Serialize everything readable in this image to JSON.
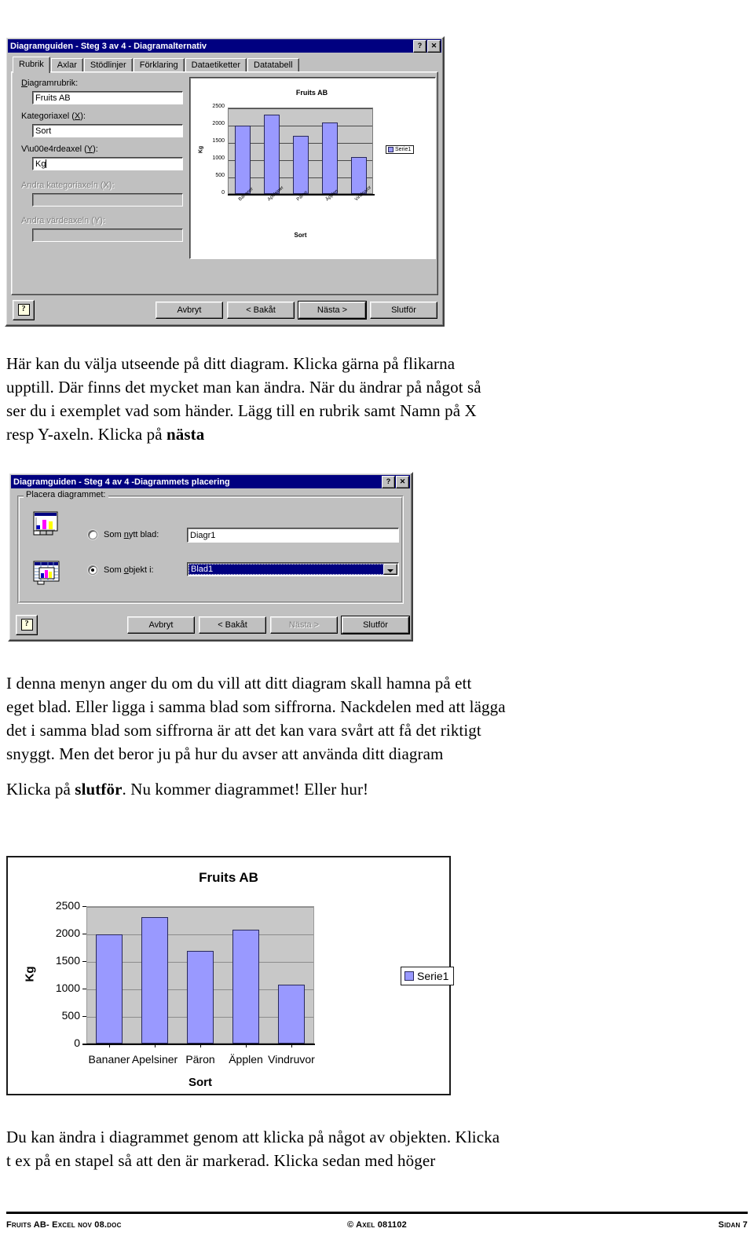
{
  "dialog3": {
    "title": "Diagramguiden - Steg 3 av 4 - Diagramalternativ",
    "help_btn": "?",
    "close_btn": "✕",
    "tabs": [
      {
        "label": "Rubrik",
        "active": true
      },
      {
        "label": "Axlar",
        "active": false
      },
      {
        "label": "Stödlinjer",
        "active": false
      },
      {
        "label": "Förklaring",
        "active": false
      },
      {
        "label": "Dataetiketter",
        "active": false
      },
      {
        "label": "Datatabell",
        "active": false
      }
    ],
    "fields": [
      {
        "label": "Diagramrubrik:",
        "value": "Fruits AB",
        "disabled": false,
        "caret": false
      },
      {
        "label": "Kategoriaxel (X):",
        "value": "Sort",
        "disabled": false,
        "caret": false
      },
      {
        "label": "Värdeaxel (Y):",
        "value": "Kg",
        "disabled": false,
        "caret": true
      },
      {
        "label": "Andra kategoriaxeln (X):",
        "value": "",
        "disabled": true,
        "caret": false
      },
      {
        "label": "Andra värdeaxeln (Y):",
        "value": "",
        "disabled": true,
        "caret": false
      }
    ],
    "buttons": [
      {
        "label": "Avbryt",
        "state": "normal"
      },
      {
        "label": "< Bakåt",
        "state": "normal"
      },
      {
        "label": "Nästa >",
        "state": "default"
      },
      {
        "label": "Slutför",
        "state": "normal"
      }
    ]
  },
  "dialog4": {
    "title": "Diagramguiden - Steg 4 av 4 -Diagrammets placering",
    "help_btn": "?",
    "close_btn": "✕",
    "group_label": "Placera diagrammet:",
    "options": [
      {
        "label": "Som nytt blad:",
        "selected": false,
        "value": "Diagr1",
        "control": "textbox"
      },
      {
        "label": "Som objekt i:",
        "selected": true,
        "value": "Blad1",
        "control": "combobox"
      }
    ],
    "buttons": [
      {
        "label": "Avbryt",
        "state": "normal"
      },
      {
        "label": "< Bakåt",
        "state": "normal"
      },
      {
        "label": "Nästa >",
        "state": "disabled"
      },
      {
        "label": "Slutför",
        "state": "default"
      }
    ]
  },
  "text": {
    "p1_line1": "Här kan du välja utseende på ditt diagram. Klicka gärna på flikarna",
    "p1_line2": "upptill. Där finns det mycket man kan ändra. När du ändrar på något så",
    "p1_line3": "ser du i exemplet vad som händer. Lägg till en rubrik samt Namn på X",
    "p1_line4_a": "resp Y-axeln. Klicka på ",
    "p1_line4_b": "nästa",
    "p2_line1": "I denna menyn anger du om du vill att ditt diagram skall hamna på ett",
    "p2_line2": "eget blad. Eller ligga i samma blad som siffrorna. Nackdelen med att lägga",
    "p2_line3": "det i samma blad som siffrorna är att det kan vara svårt att få det riktigt",
    "p2_line4": "snyggt. Men det beror ju på hur du avser att använda ditt diagram",
    "p3_a": "Klicka på ",
    "p3_b": "slutför",
    "p3_c": ". Nu kommer diagrammet! Eller hur!",
    "p4_line1": "Du kan ändra i diagrammet genom att klicka på något av objekten. Klicka",
    "p4_line2": "t ex på en stapel så att den är markerad. Klicka sedan med höger"
  },
  "footer": {
    "left": "Fruits AB- Excel nov 08.doc",
    "center": "© Axel 081102",
    "right": "Sidan 7"
  },
  "chart_data": {
    "type": "bar",
    "title": "Fruits AB",
    "categories": [
      "Bananer",
      "Apelsiner",
      "Päron",
      "Äpplen",
      "Vindruvor"
    ],
    "values": [
      1980,
      2300,
      1690,
      2070,
      1075
    ],
    "series": [
      {
        "name": "Serie1",
        "values": [
          1980,
          2300,
          1690,
          2070,
          1075
        ],
        "color": "#9999ff"
      }
    ],
    "xlabel": "Sort",
    "ylabel": "Kg",
    "ylim": [
      0,
      2500
    ],
    "yticks": [
      0,
      500,
      1000,
      1500,
      2000,
      2500
    ],
    "grid": true,
    "legend": [
      "Serie1"
    ],
    "legend_position": "right",
    "plot_bgcolor": "#c8c8c8"
  },
  "preview_chart": {
    "type": "bar",
    "title": "Fruits AB",
    "categories": [
      "Bananer",
      "Apelsiner",
      "Päron",
      "Äpplen",
      "Vindruvor"
    ],
    "values": [
      1980,
      2300,
      1690,
      2070,
      1075
    ],
    "xlabel": "Sort",
    "ylabel": "Kg",
    "ylim": [
      0,
      2500
    ],
    "yticks": [
      0,
      500,
      1000,
      1500,
      2000,
      2500
    ],
    "legend": [
      "Serie1"
    ]
  }
}
